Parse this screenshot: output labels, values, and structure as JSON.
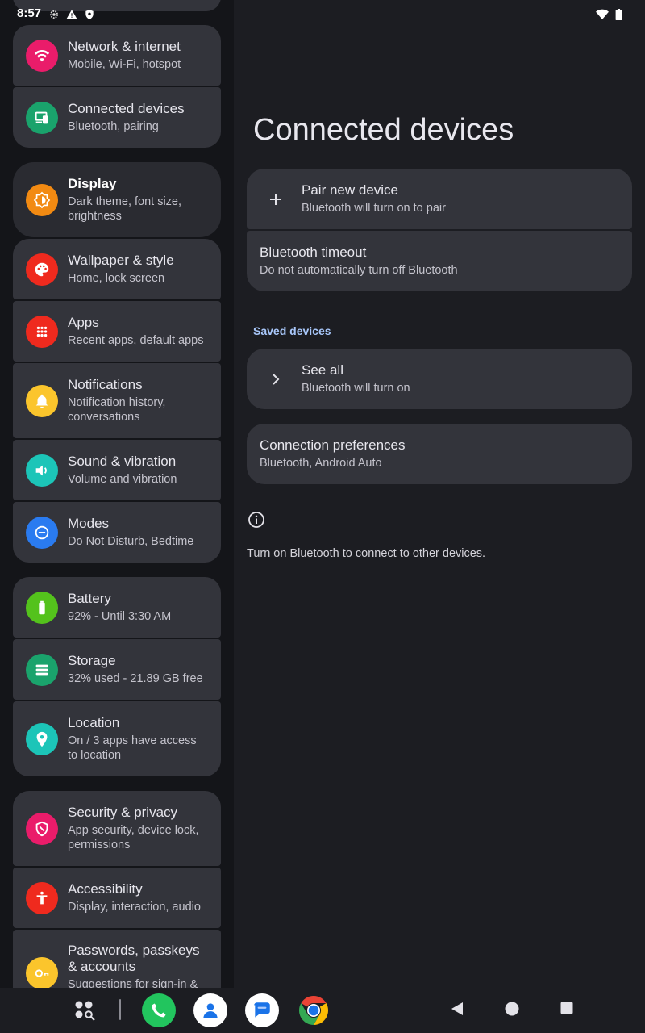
{
  "status": {
    "time": "8:57"
  },
  "sidebar": {
    "items": [
      {
        "title": "Network & internet",
        "subtitle": "Mobile, Wi‑Fi, hotspot",
        "icon": "wifi-icon",
        "color": "#ea1c6a"
      },
      {
        "title": "Connected devices",
        "subtitle": "Bluetooth, pairing",
        "icon": "devices-icon",
        "color": "#1aa36c"
      },
      {
        "title": "Display",
        "subtitle": "Dark theme, font size, brightness",
        "subtitle_line1": "Dark theme, font size,",
        "subtitle_line2": "brightness",
        "icon": "brightness-icon",
        "color": "#f28a12"
      },
      {
        "title": "Wallpaper & style",
        "subtitle": "Home, lock screen",
        "icon": "palette-icon",
        "color": "#ef2a1e"
      },
      {
        "title": "Apps",
        "subtitle": "Recent apps, default apps",
        "icon": "apps-grid-icon",
        "color": "#ef2a1e"
      },
      {
        "title": "Notifications",
        "subtitle_line1": "Notification history,",
        "subtitle_line2": "conversations",
        "icon": "bell-icon",
        "color": "#fbc52c"
      },
      {
        "title": "Sound & vibration",
        "subtitle": "Volume and vibration",
        "icon": "volume-icon",
        "color": "#1cc5b8"
      },
      {
        "title": "Modes",
        "subtitle": "Do Not Disturb, Bedtime",
        "icon": "do-not-disturb-icon",
        "color": "#2a7bf0"
      },
      {
        "title": "Battery",
        "subtitle": "92% - Until 3:30 AM",
        "icon": "battery-icon",
        "color": "#54c21c"
      },
      {
        "title": "Storage",
        "subtitle": "32% used - 21.89 GB free",
        "icon": "storage-icon",
        "color": "#1aa36c"
      },
      {
        "title": "Location",
        "subtitle_line1": "On / 3 apps have access",
        "subtitle_line2": "to location",
        "icon": "location-pin-icon",
        "color": "#1cc5b8"
      },
      {
        "title": "Security & privacy",
        "subtitle_line1": "App security, device lock,",
        "subtitle_line2": "permissions",
        "icon": "shield-icon",
        "color": "#ea1c6a"
      },
      {
        "title": "Accessibility",
        "subtitle": "Display, interaction, audio",
        "icon": "accessibility-icon",
        "color": "#ef2a1e"
      },
      {
        "title_line1": "Passwords, passkeys",
        "title_line2": "& accounts",
        "subtitle": "Suggestions for sign-in &",
        "icon": "key-icon",
        "color": "#fbc52c"
      }
    ]
  },
  "main": {
    "title": "Connected devices",
    "pair": {
      "title": "Pair new device",
      "subtitle": "Bluetooth will turn on to pair"
    },
    "timeout": {
      "title": "Bluetooth timeout",
      "subtitle": "Do not automatically turn off Bluetooth"
    },
    "saved_label": "Saved devices",
    "see_all": {
      "title": "See all",
      "subtitle": "Bluetooth will turn on"
    },
    "prefs": {
      "title": "Connection preferences",
      "subtitle": "Bluetooth, Android Auto"
    },
    "info": "Turn on Bluetooth to connect to other devices."
  },
  "colors": {
    "accent": "#a8c7fa",
    "card": "#33343b",
    "left_bg": "#141519",
    "right_bg": "#1c1d22"
  }
}
